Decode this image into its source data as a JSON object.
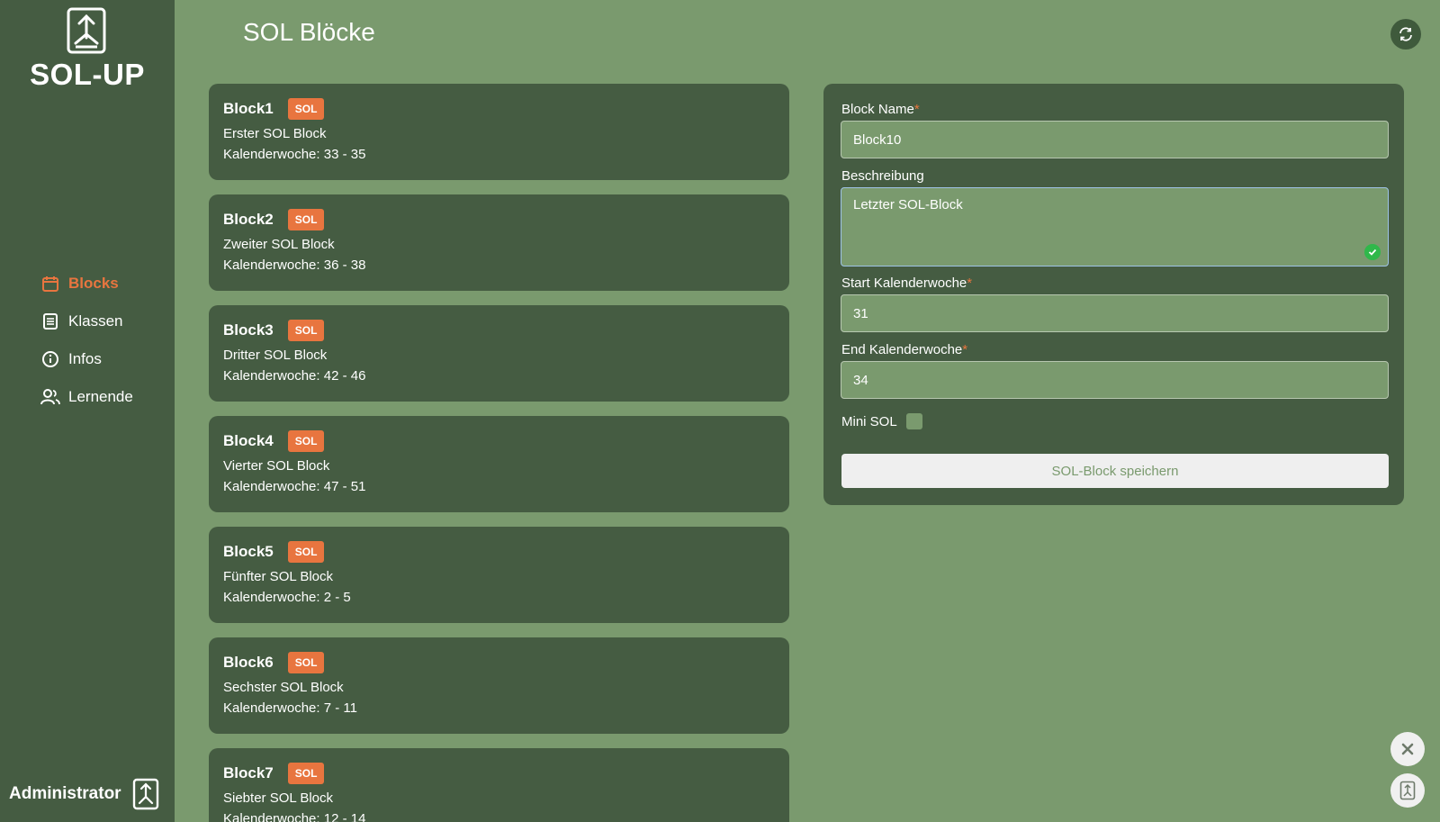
{
  "app": {
    "name": "SOL-UP",
    "user": "Administrator"
  },
  "nav": {
    "items": [
      {
        "label": "Blocks",
        "icon": "calendar-icon",
        "active": true
      },
      {
        "label": "Klassen",
        "icon": "list-icon",
        "active": false
      },
      {
        "label": "Infos",
        "icon": "info-icon",
        "active": false
      },
      {
        "label": "Lernende",
        "icon": "users-icon",
        "active": false
      }
    ]
  },
  "page": {
    "title": "SOL Blöcke"
  },
  "blocks": [
    {
      "name": "Block1",
      "badge": "SOL",
      "description": "Erster SOL Block",
      "weeks": "Kalenderwoche: 33 - 35"
    },
    {
      "name": "Block2",
      "badge": "SOL",
      "description": "Zweiter SOL Block",
      "weeks": "Kalenderwoche: 36 - 38"
    },
    {
      "name": "Block3",
      "badge": "SOL",
      "description": "Dritter SOL Block",
      "weeks": "Kalenderwoche: 42 - 46"
    },
    {
      "name": "Block4",
      "badge": "SOL",
      "description": "Vierter SOL Block",
      "weeks": "Kalenderwoche: 47 - 51"
    },
    {
      "name": "Block5",
      "badge": "SOL",
      "description": "Fünfter SOL Block",
      "weeks": "Kalenderwoche: 2 - 5"
    },
    {
      "name": "Block6",
      "badge": "SOL",
      "description": "Sechster SOL Block",
      "weeks": "Kalenderwoche: 7 - 11"
    },
    {
      "name": "Block7",
      "badge": "SOL",
      "description": "Siebter SOL Block",
      "weeks": "Kalenderwoche: 12 - 14"
    }
  ],
  "form": {
    "name_label": "Block Name",
    "name_value": "Block10",
    "desc_label": "Beschreibung",
    "desc_value": "Letzter SOL-Block",
    "start_label": "Start Kalenderwoche",
    "start_value": "31",
    "end_label": "End Kalenderwoche",
    "end_value": "34",
    "mini_label": "Mini SOL",
    "mini_checked": false,
    "save_label": "SOL-Block speichern",
    "required_marker": "*"
  },
  "colors": {
    "background": "#7a9a6e",
    "panel": "#455c42",
    "accent": "#e8753f",
    "success": "#2fb84a"
  }
}
